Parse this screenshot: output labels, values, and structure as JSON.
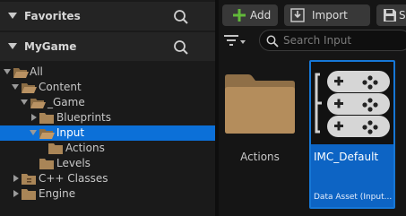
{
  "sidebar": {
    "favorites": {
      "label": "Favorites"
    },
    "project": {
      "label": "MyGame"
    },
    "tree": [
      {
        "label": "All"
      },
      {
        "label": "Content"
      },
      {
        "label": "_Game"
      },
      {
        "label": "Blueprints"
      },
      {
        "label": "Input"
      },
      {
        "label": "Actions"
      },
      {
        "label": "Levels"
      },
      {
        "label": "C++ Classes"
      },
      {
        "label": "Engine"
      }
    ]
  },
  "toolbar": {
    "add_label": "Add",
    "import_label": "Import",
    "save_label": "Sa"
  },
  "search": {
    "placeholder": "Search Input"
  },
  "assets": [
    {
      "name": "Actions",
      "type": "folder"
    },
    {
      "name": "IMC_Default",
      "subtitle": "Data Asset (Input..."
    }
  ],
  "colors": {
    "selection": "#0c70d8",
    "folder": "#b08a57",
    "add_icon": "#62b93a",
    "panel_bg": "#1a1a1a"
  },
  "icons": [
    "search-icon",
    "folder-icon",
    "folder-open-icon",
    "plus-icon",
    "import-icon",
    "save-icon",
    "filter-icon",
    "gamepad-icon"
  ]
}
